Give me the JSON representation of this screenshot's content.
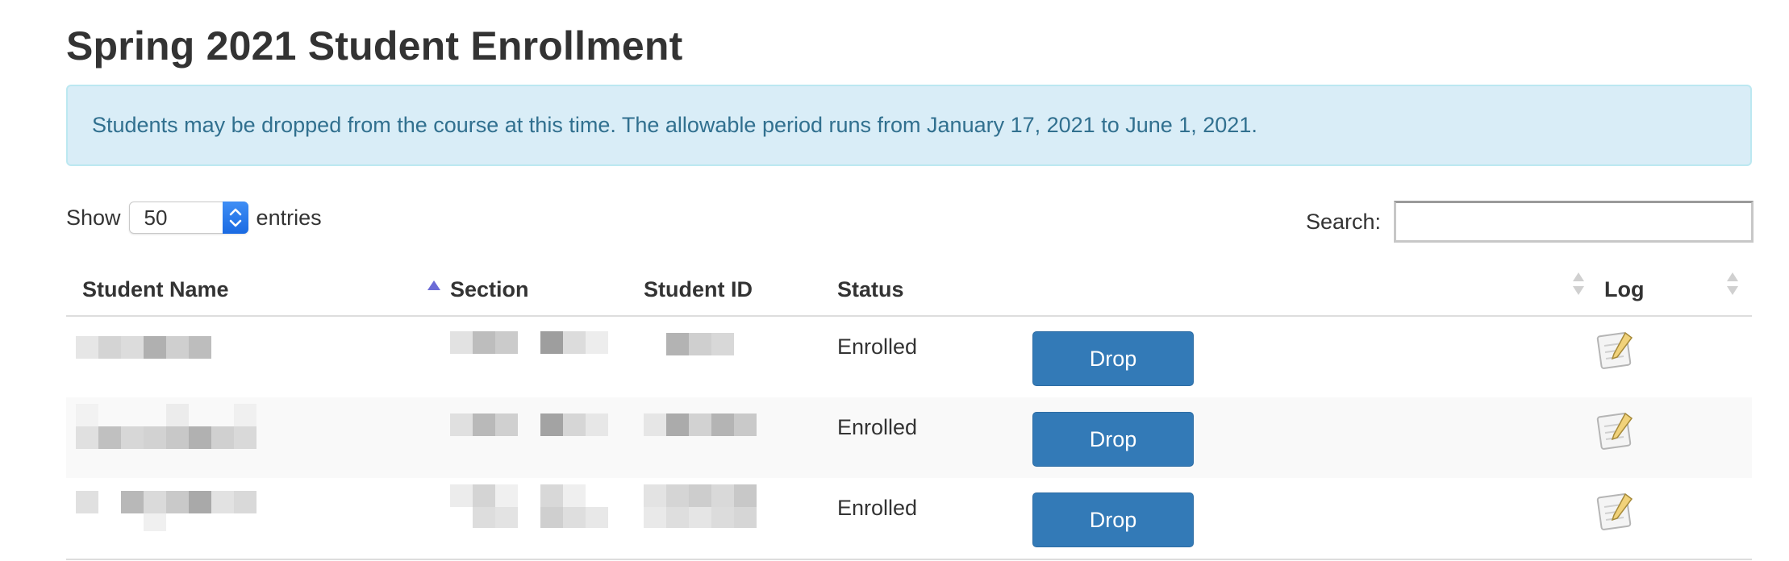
{
  "page": {
    "title": "Spring 2021 Student Enrollment"
  },
  "notice": {
    "text": "Students may be dropped from the course at this time. The allowable period runs from January 17, 2021 to June 1, 2021."
  },
  "length_control": {
    "prefix": "Show",
    "value": "50",
    "suffix": "entries"
  },
  "search": {
    "label": "Search:",
    "value": ""
  },
  "table": {
    "columns": [
      "Student Name",
      "Section",
      "Student ID",
      "Status",
      "",
      "Log"
    ],
    "sorted_column": "Student Name",
    "sort_direction": "ascending",
    "rows": [
      {
        "status": "Enrolled",
        "action": "Drop",
        "log_icon": "notepad-pencil-icon"
      },
      {
        "status": "Enrolled",
        "action": "Drop",
        "log_icon": "notepad-pencil-icon"
      },
      {
        "status": "Enrolled",
        "action": "Drop",
        "log_icon": "notepad-pencil-icon"
      }
    ]
  },
  "colors": {
    "notice_bg": "#d9edf7",
    "notice_border": "#bce8f1",
    "notice_text": "#31708f",
    "button_primary": "#337ab7",
    "sort_active": "#6b6bd6"
  }
}
